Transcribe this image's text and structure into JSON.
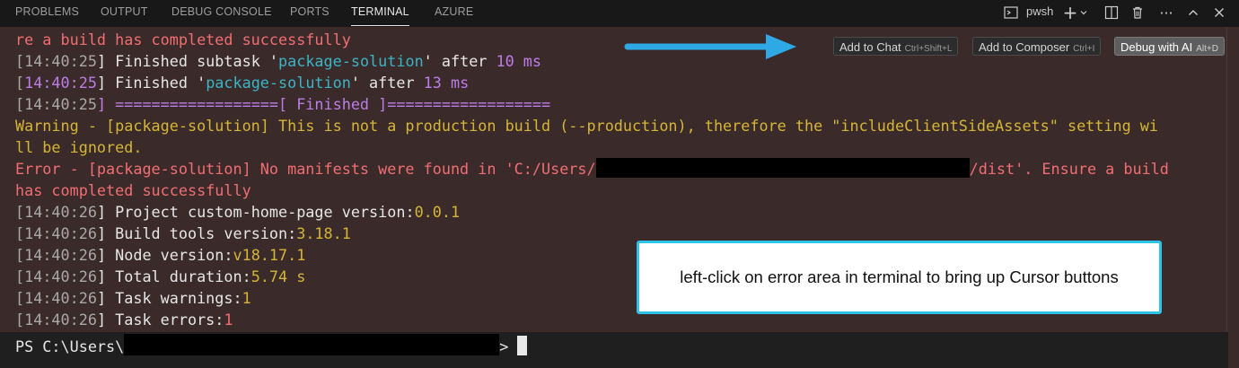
{
  "tabs": [
    {
      "label": "PROBLEMS"
    },
    {
      "label": "OUTPUT"
    },
    {
      "label": "DEBUG CONSOLE"
    },
    {
      "label": "PORTS"
    },
    {
      "label": "TERMINAL"
    },
    {
      "label": "AZURE"
    }
  ],
  "toolbar": {
    "shell_label": "pwsh",
    "icons": [
      "terminal-icon",
      "plus-icon",
      "chevron-down-icon",
      "split-icon",
      "trash-icon",
      "more-icon",
      "chevron-up-icon",
      "close-icon"
    ]
  },
  "terminal": {
    "line1": "re a build has completed successfully",
    "ts1": "14:40:25",
    "subtask_pre": "] Finished subtask '",
    "subtask_name": "package-solution",
    "subtask_after": "' after ",
    "subtask_time": "10 ms",
    "finished_pre": "] Finished '",
    "finished_name": "package-solution",
    "finished_after": "' after ",
    "finished_time": "13 ms",
    "finished_banner": "] ==================[ Finished ]==================",
    "warning1": "Warning - [package-solution] This is not a production build (--production), therefore the \"includeClientSideAssets\" setting wi",
    "warning2": "ll be ignored.",
    "error1_pre": "Error - [package-solution] No manifests were found in 'C:/Users/",
    "error1_post": "/dist'. Ensure a build",
    "error2": "has completed successfully",
    "ts2": "14:40:26",
    "project_label": "] Project custom-home-page version:",
    "project_version": "0.0.1",
    "build_label": "] Build tools version:",
    "build_version": "3.18.1",
    "node_label": "] Node version:",
    "node_version": "v18.17.1",
    "duration_label": "] Total duration:",
    "duration_value": "5.74 s",
    "warnings_label": "] Task warnings:",
    "warnings_value": "1",
    "errors_label": "] Task errors:",
    "errors_value": "1",
    "prompt_pre": "PS C:\\Users\\",
    "prompt_post": ">"
  },
  "cursor_buttons": [
    {
      "label": "Add to Chat",
      "shortcut": "Ctrl+Shift+L"
    },
    {
      "label": "Add to Composer",
      "shortcut": "Ctrl+I"
    },
    {
      "label": "Debug with AI",
      "shortcut": "Alt+D"
    }
  ],
  "annotation": {
    "text": "left-click on error area in terminal to bring up Cursor buttons"
  },
  "colors": {
    "terminal_bg": "#3a2b2a",
    "error": "#f16d72",
    "warning": "#d5b536",
    "accent_cyan": "#3ab4c6",
    "timestamp_magenta": "#bd7de6",
    "annotation_border": "#2ec1ea",
    "arrow": "#2fa9e6"
  }
}
